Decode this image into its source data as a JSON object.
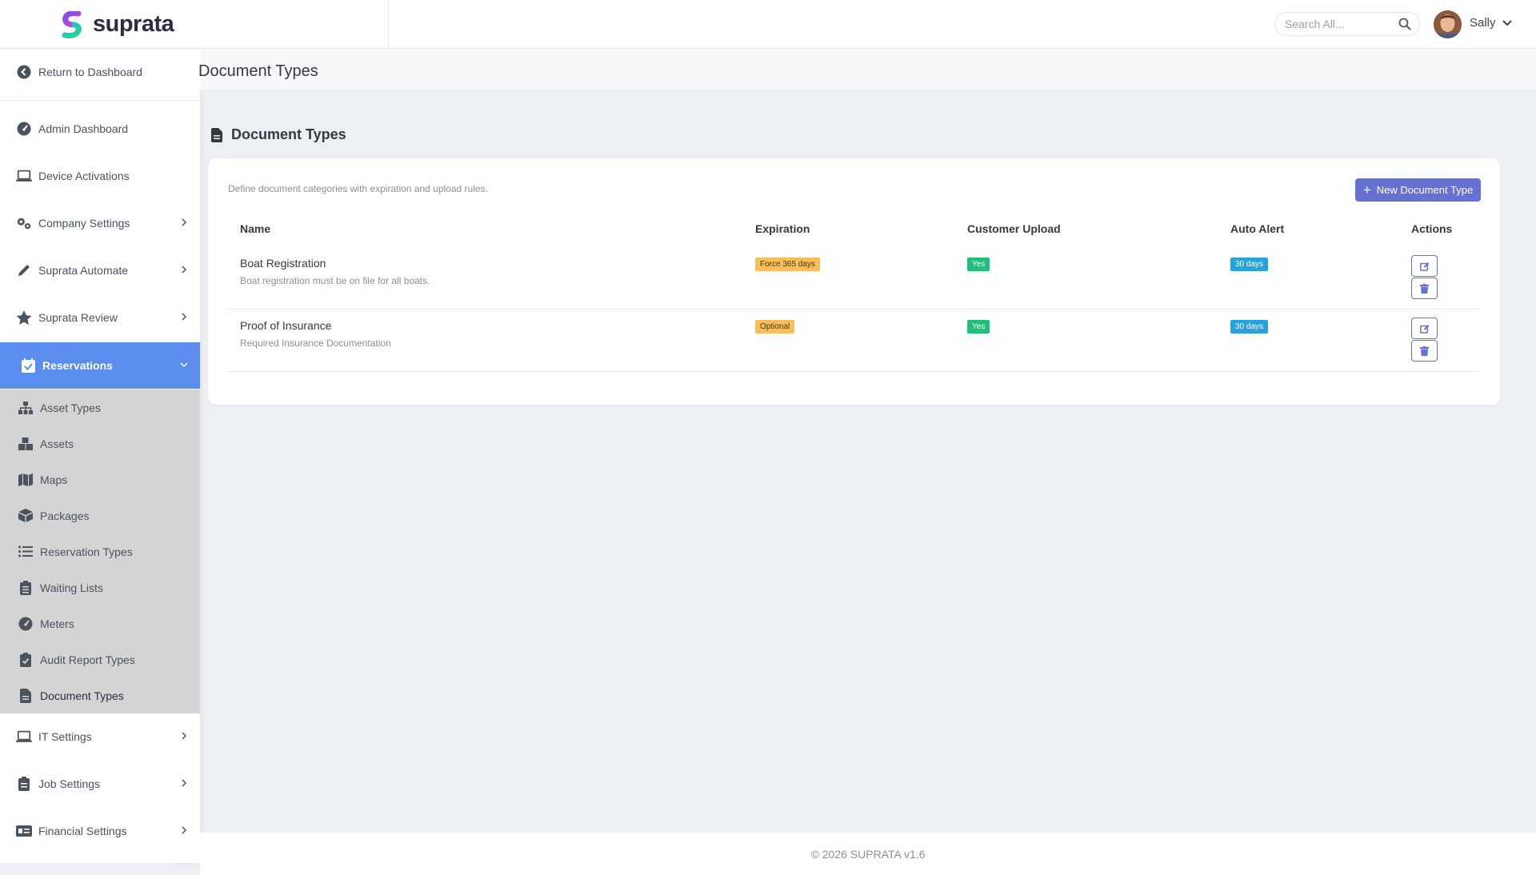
{
  "brand": {
    "name": "suprata"
  },
  "search": {
    "placeholder": "Search All..."
  },
  "user": {
    "name": "Sally"
  },
  "sidebar": {
    "return_label": "Return to Dashboard",
    "items": [
      {
        "label": "Admin Dashboard",
        "icon": "gauge-icon"
      },
      {
        "label": "Device Activations",
        "icon": "laptop-icon"
      },
      {
        "label": "Company Settings",
        "icon": "gears-icon"
      },
      {
        "label": "Suprata Automate",
        "icon": "pencil-icon"
      },
      {
        "label": "Suprata Review",
        "icon": "star-icon"
      },
      {
        "label": "Reservations",
        "icon": "calendar-check-icon"
      }
    ],
    "submenu": [
      {
        "label": "Asset Types",
        "icon": "sitemap-icon"
      },
      {
        "label": "Assets",
        "icon": "boxes-icon"
      },
      {
        "label": "Maps",
        "icon": "map-icon"
      },
      {
        "label": "Packages",
        "icon": "box-icon"
      },
      {
        "label": "Reservation Types",
        "icon": "list-icon"
      },
      {
        "label": "Waiting Lists",
        "icon": "clipboard-list-icon"
      },
      {
        "label": "Meters",
        "icon": "gauge-icon"
      },
      {
        "label": "Audit Report Types",
        "icon": "clipboard-check-icon"
      },
      {
        "label": "Document Types",
        "icon": "file-icon"
      }
    ],
    "bottom_items": [
      {
        "label": "IT Settings",
        "icon": "laptop-icon"
      },
      {
        "label": "Job Settings",
        "icon": "clipboard-icon"
      },
      {
        "label": "Financial Settings",
        "icon": "money-check-icon"
      }
    ]
  },
  "page": {
    "title": "Document Types"
  },
  "section": {
    "title": "Document Types",
    "description": "Define document categories with expiration and upload rules.",
    "new_button": "New Document Type"
  },
  "table": {
    "headers": {
      "name": "Name",
      "expiration": "Expiration",
      "customer_upload": "Customer Upload",
      "auto_alert": "Auto Alert",
      "actions": "Actions"
    },
    "rows": [
      {
        "name": "Boat Registration",
        "description": "Boat registration must be on file for all boats.",
        "expiration": "Force 365 days",
        "customer_upload": "Yes",
        "auto_alert": "30 days"
      },
      {
        "name": "Proof of Insurance",
        "description": "Required Insurance Documentation",
        "expiration": "Optional",
        "customer_upload": "Yes",
        "auto_alert": "30 days"
      }
    ]
  },
  "footer": {
    "text": "© 2026 SUPRATA v1.6"
  },
  "colors": {
    "accent": "#5b8def",
    "button": "#6672d2",
    "badge_orange": "#f9bd5c",
    "badge_green": "#1fc07a",
    "badge_blue": "#26a3dd"
  }
}
